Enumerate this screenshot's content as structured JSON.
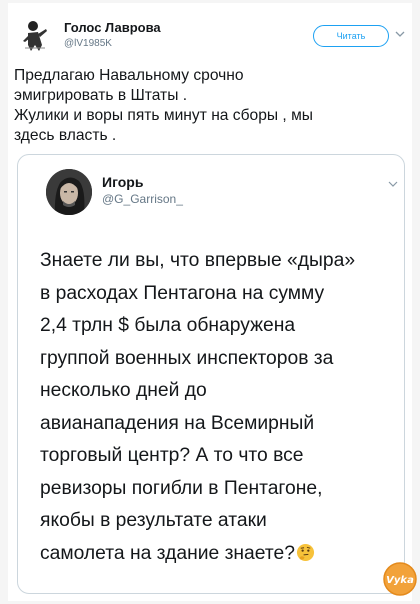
{
  "header": {
    "display_name": "Голос Лаврова",
    "handle": "@lV1985K",
    "follow_label": "Читать"
  },
  "tweet": {
    "text": "Предлагаю Навальному срочно\nэмигрировать в Штаты .\nЖулики и воры пять минут на сборы , мы\nздесь власть ."
  },
  "quoted_tweet": {
    "display_name": "Игорь",
    "handle": "@G_Garrison_",
    "text": "Знаете ли вы, что впервые «дыра»\nв расходах Пентагона на сумму\n2,4 трлн $ была обнаружена\nгруппой военных инспекторов за\nнесколько дней  до\nавианападения на Всемирный\nторговый центр? А то что все\nревизоры  погибли в Пентагоне,\nякобы в результате атаки\nсамолета на здание знаете?",
    "emoji": "thinking-face"
  },
  "watermark": {
    "text": "Vyka"
  },
  "colors": {
    "accent": "#1da1f2",
    "border": "#ccd6dd",
    "secondary_text": "#657786",
    "watermark_orange": "#f2a23a"
  }
}
